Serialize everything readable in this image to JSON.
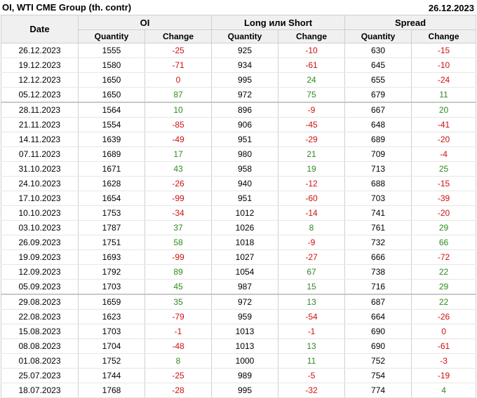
{
  "header": {
    "title": "OI, WTI CME Group (th. contr)",
    "date": "26.12.2023"
  },
  "columns": {
    "date": "Date",
    "groups": [
      "OI",
      "Long или Short",
      "Spread"
    ],
    "sub": [
      "Quantity",
      "Change",
      "Quantity",
      "Change",
      "Quantity",
      "Change"
    ]
  },
  "rows": [
    {
      "date": "26.12.2023",
      "oi_q": "1555",
      "oi_c": "-25",
      "ls_q": "925",
      "ls_c": "-10",
      "sp_q": "630",
      "sp_c": "-15"
    },
    {
      "date": "19.12.2023",
      "oi_q": "1580",
      "oi_c": "-71",
      "ls_q": "934",
      "ls_c": "-61",
      "sp_q": "645",
      "sp_c": "-10"
    },
    {
      "date": "12.12.2023",
      "oi_q": "1650",
      "oi_c": "0",
      "ls_q": "995",
      "ls_c": "24",
      "sp_q": "655",
      "sp_c": "-24"
    },
    {
      "date": "05.12.2023",
      "oi_q": "1650",
      "oi_c": "87",
      "ls_q": "972",
      "ls_c": "75",
      "sp_q": "679",
      "sp_c": "11"
    },
    {
      "date": "28.11.2023",
      "oi_q": "1564",
      "oi_c": "10",
      "ls_q": "896",
      "ls_c": "-9",
      "sp_q": "667",
      "sp_c": "20"
    },
    {
      "date": "21.11.2023",
      "oi_q": "1554",
      "oi_c": "-85",
      "ls_q": "906",
      "ls_c": "-45",
      "sp_q": "648",
      "sp_c": "-41"
    },
    {
      "date": "14.11.2023",
      "oi_q": "1639",
      "oi_c": "-49",
      "ls_q": "951",
      "ls_c": "-29",
      "sp_q": "689",
      "sp_c": "-20"
    },
    {
      "date": "07.11.2023",
      "oi_q": "1689",
      "oi_c": "17",
      "ls_q": "980",
      "ls_c": "21",
      "sp_q": "709",
      "sp_c": "-4"
    },
    {
      "date": "31.10.2023",
      "oi_q": "1671",
      "oi_c": "43",
      "ls_q": "958",
      "ls_c": "19",
      "sp_q": "713",
      "sp_c": "25"
    },
    {
      "date": "24.10.2023",
      "oi_q": "1628",
      "oi_c": "-26",
      "ls_q": "940",
      "ls_c": "-12",
      "sp_q": "688",
      "sp_c": "-15"
    },
    {
      "date": "17.10.2023",
      "oi_q": "1654",
      "oi_c": "-99",
      "ls_q": "951",
      "ls_c": "-60",
      "sp_q": "703",
      "sp_c": "-39"
    },
    {
      "date": "10.10.2023",
      "oi_q": "1753",
      "oi_c": "-34",
      "ls_q": "1012",
      "ls_c": "-14",
      "sp_q": "741",
      "sp_c": "-20"
    },
    {
      "date": "03.10.2023",
      "oi_q": "1787",
      "oi_c": "37",
      "ls_q": "1026",
      "ls_c": "8",
      "sp_q": "761",
      "sp_c": "29"
    },
    {
      "date": "26.09.2023",
      "oi_q": "1751",
      "oi_c": "58",
      "ls_q": "1018",
      "ls_c": "-9",
      "sp_q": "732",
      "sp_c": "66"
    },
    {
      "date": "19.09.2023",
      "oi_q": "1693",
      "oi_c": "-99",
      "ls_q": "1027",
      "ls_c": "-27",
      "sp_q": "666",
      "sp_c": "-72"
    },
    {
      "date": "12.09.2023",
      "oi_q": "1792",
      "oi_c": "89",
      "ls_q": "1054",
      "ls_c": "67",
      "sp_q": "738",
      "sp_c": "22"
    },
    {
      "date": "05.09.2023",
      "oi_q": "1703",
      "oi_c": "45",
      "ls_q": "987",
      "ls_c": "15",
      "sp_q": "716",
      "sp_c": "29"
    },
    {
      "date": "29.08.2023",
      "oi_q": "1659",
      "oi_c": "35",
      "ls_q": "972",
      "ls_c": "13",
      "sp_q": "687",
      "sp_c": "22"
    },
    {
      "date": "22.08.2023",
      "oi_q": "1623",
      "oi_c": "-79",
      "ls_q": "959",
      "ls_c": "-54",
      "sp_q": "664",
      "sp_c": "-26"
    },
    {
      "date": "15.08.2023",
      "oi_q": "1703",
      "oi_c": "-1",
      "ls_q": "1013",
      "ls_c": "-1",
      "sp_q": "690",
      "sp_c": "0"
    },
    {
      "date": "08.08.2023",
      "oi_q": "1704",
      "oi_c": "-48",
      "ls_q": "1013",
      "ls_c": "13",
      "sp_q": "690",
      "sp_c": "-61"
    },
    {
      "date": "01.08.2023",
      "oi_q": "1752",
      "oi_c": "8",
      "ls_q": "1000",
      "ls_c": "11",
      "sp_q": "752",
      "sp_c": "-3"
    },
    {
      "date": "25.07.2023",
      "oi_q": "1744",
      "oi_c": "-25",
      "ls_q": "989",
      "ls_c": "-5",
      "sp_q": "754",
      "sp_c": "-19"
    },
    {
      "date": "18.07.2023",
      "oi_q": "1768",
      "oi_c": "-28",
      "ls_q": "995",
      "ls_c": "-32",
      "sp_q": "774",
      "sp_c": "4"
    }
  ],
  "colors": {
    "positive": "#2e8b1e",
    "negative": "#d01010",
    "header_bg": "#f0f0f0"
  }
}
